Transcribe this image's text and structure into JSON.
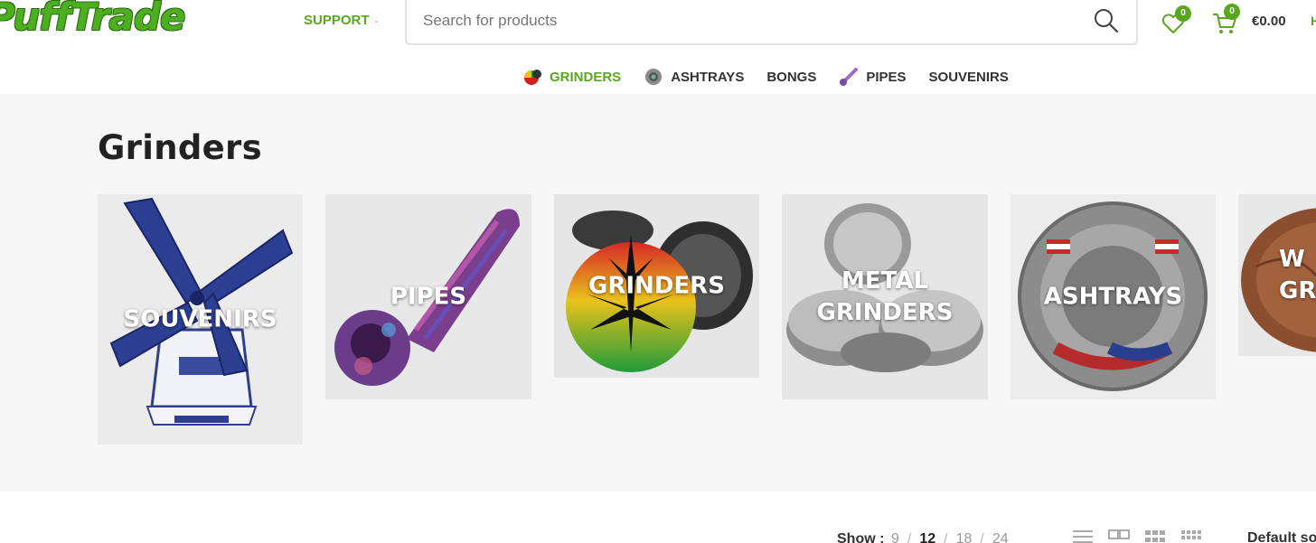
{
  "header": {
    "logo_text": "PuffTrade",
    "support_label": "SUPPORT",
    "search_placeholder": "Search for products",
    "wishlist_count": "0",
    "cart_count": "0",
    "cart_total": "€0.00",
    "edge_letter": "H"
  },
  "category_nav": [
    {
      "label": "GRINDERS",
      "icon": "grinder-thumb",
      "active": true
    },
    {
      "label": "ASHTRAYS",
      "icon": "ashtray-thumb",
      "active": false
    },
    {
      "label": "BONGS",
      "icon": "",
      "active": false
    },
    {
      "label": "PIPES",
      "icon": "pipe-thumb",
      "active": false
    },
    {
      "label": "SOUVENIRS",
      "icon": "",
      "active": false
    }
  ],
  "page_title": "Grinders",
  "category_cards": [
    {
      "label": "SOUVENIRS",
      "image": "windmill"
    },
    {
      "label": "PIPES",
      "image": "glass-pipe"
    },
    {
      "label": "GRINDERS",
      "image": "rasta-grinder"
    },
    {
      "label": "METAL\nGRINDERS",
      "image": "metal-grinder"
    },
    {
      "label": "ASHTRAYS",
      "image": "amsterdam-ashtray"
    },
    {
      "label": "W\nGR",
      "image": "wood-grinder"
    }
  ],
  "toolbar": {
    "show_label": "Show :",
    "per_page_options": [
      "9",
      "12",
      "18",
      "24"
    ],
    "per_page_selected": "12",
    "view_modes": [
      "list-view-icon",
      "grid-2-icon",
      "grid-3-icon",
      "grid-4-icon"
    ],
    "sort_label": "Default sorting"
  },
  "colors": {
    "brand_green": "#5aa71f",
    "hero_bg": "#f7f7f7"
  }
}
